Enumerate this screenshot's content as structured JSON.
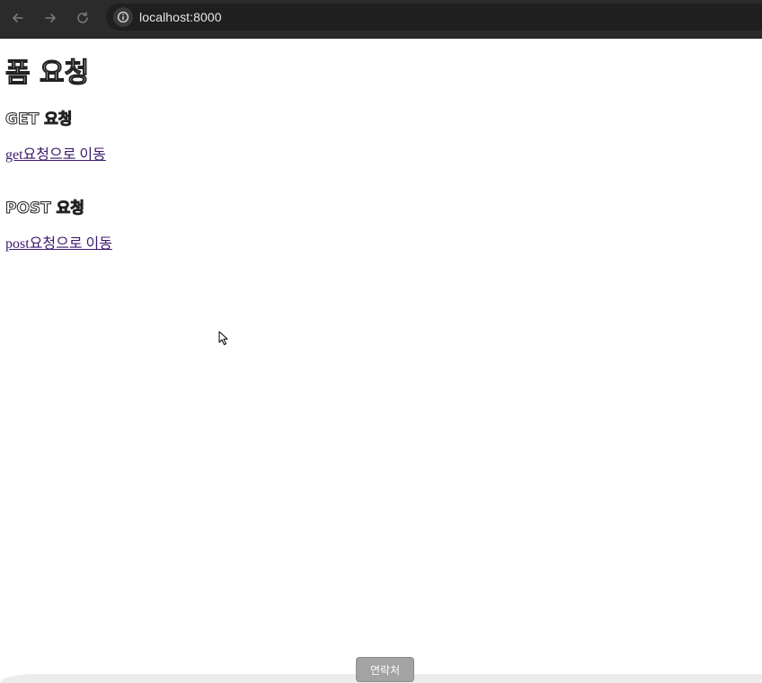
{
  "browser": {
    "url": "localhost:8000",
    "colors": {
      "toolbar": "#2b2b2b",
      "omnibox": "#1f1f1f",
      "url_text": "#e8e8e8"
    }
  },
  "page": {
    "title": "폼 요청",
    "get_section": {
      "heading": "GET 요청",
      "link": "get요청으로 이동"
    },
    "post_section": {
      "heading": "POST 요청",
      "link": "post요청으로 이동"
    },
    "colors": {
      "link": "#3b1a6e",
      "background": "#ffffff"
    }
  },
  "contact_button": {
    "label": "연락처",
    "color": "#a3a3a3"
  }
}
